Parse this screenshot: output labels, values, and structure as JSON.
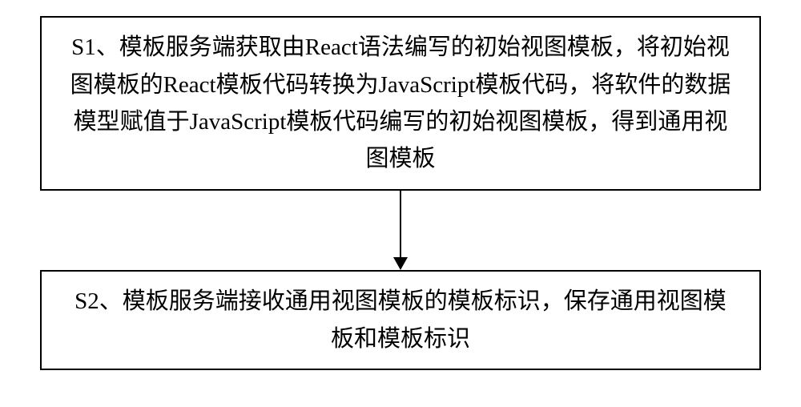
{
  "step1": {
    "text": "S1、模板服务端获取由React语法编写的初始视图模板，将初始视图模板的React模板代码转换为JavaScript模板代码，将软件的数据模型赋值于JavaScript模板代码编写的初始视图模板，得到通用视图模板"
  },
  "step2": {
    "text": "S2、模板服务端接收通用视图模板的模板标识，保存通用视图模板和模板标识"
  }
}
